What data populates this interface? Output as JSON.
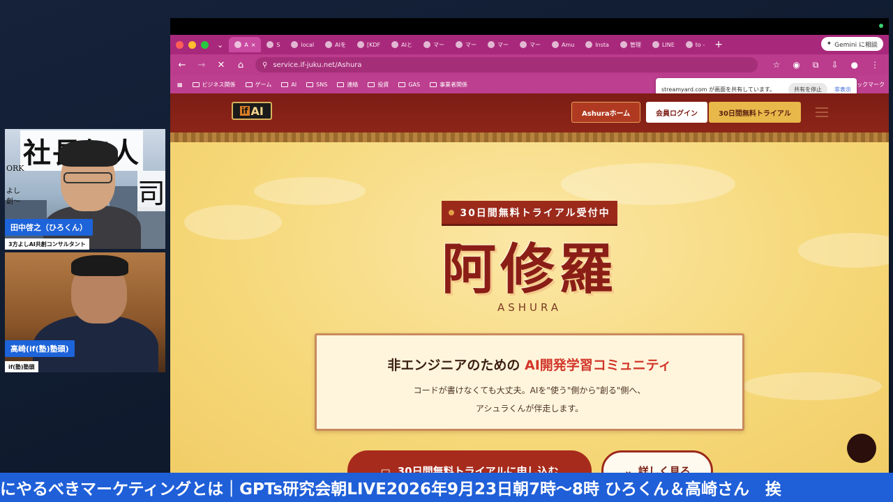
{
  "webcams": [
    {
      "name": "田中啓之（ひろくん）",
      "title": "3方よしAI共創コンサルタント",
      "background_text": "社長無人",
      "background_side_text_1": "ORK",
      "background_side_text_2": "よし",
      "background_side_text_3": "創～",
      "background_right_text": "司"
    },
    {
      "name": "高崎(if(塾)塾頭)",
      "title": "if(塾)塾頭"
    }
  ],
  "browser": {
    "tabs": [
      {
        "label": "A",
        "active": true
      },
      {
        "label": "S",
        "active": false
      },
      {
        "label": "local",
        "active": false
      },
      {
        "label": "AIを",
        "active": false
      },
      {
        "label": "[KDF",
        "active": false
      },
      {
        "label": "AIと",
        "active": false
      },
      {
        "label": "マー",
        "active": false
      },
      {
        "label": "マー",
        "active": false
      },
      {
        "label": "マー",
        "active": false
      },
      {
        "label": "マー",
        "active": false
      },
      {
        "label": "Amu",
        "active": false
      },
      {
        "label": "Insta",
        "active": false
      },
      {
        "label": "管理",
        "active": false
      },
      {
        "label": "LINE",
        "active": false
      },
      {
        "label": "to - ",
        "active": false
      }
    ],
    "gemini_label": "Gemini に相談",
    "url": "service.if-juku.net/Ashura",
    "bookmarks": [
      "ビジネス関係",
      "ゲーム",
      "AI",
      "SNS",
      "連絡",
      "投資",
      "GAS",
      "事業者関係"
    ],
    "bookmarks_right": "ックマーク",
    "share_popup": {
      "message": "streamyard.com が画面を共有しています。",
      "stop_label": "共有を停止",
      "hide_label": "非表示"
    }
  },
  "site": {
    "logo": "AI",
    "logo_mark": "if",
    "nav": {
      "home": "Ashuraホーム",
      "login": "会員ログイン",
      "trial": "30日間無料トライアル"
    },
    "badge": "30日間無料トライアル受付中",
    "title_jp": "阿修羅",
    "title_en": "ASHURA",
    "card": {
      "heading_prefix": "非エンジニアのための",
      "heading_accent": "AI開発学習コミュニティ",
      "line1": "コードが書けなくても大丈夫。AIを\"使う\"側から\"創る\"側へ、",
      "line2": "アシュラくんが伴走します。"
    },
    "cta_label": "30日間無料トライアルに申し込む",
    "more_label": "詳しく見る"
  },
  "ticker": "にやるべきマーケティングとは｜GPTs研究会朝LIVE2026年9月23日朝7時～8時 ひろくん＆高崎さん　挨"
}
